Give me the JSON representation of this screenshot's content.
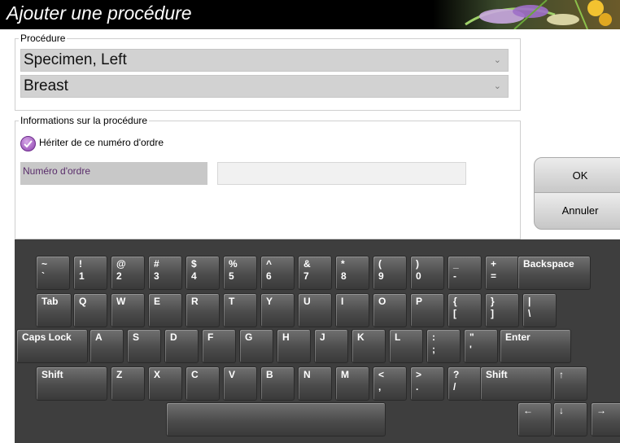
{
  "dialog": {
    "title": "Ajouter une procédure"
  },
  "procedure": {
    "legend": "Procédure",
    "procedure_value": "Specimen, Left",
    "laterality_value": "Breast",
    "chevron": "chevron-down-icon"
  },
  "info": {
    "legend": "Informations sur la procédure",
    "inherit_label": "Hériter de ce numéro d'ordre",
    "inherit_checked": true,
    "order_number_label": "Numéro d'ordre",
    "order_number_value": ""
  },
  "buttons": {
    "ok": "OK",
    "cancel": "Annuler"
  },
  "colors": {
    "title_bar": "#000000",
    "keyboard_bg": "#3e3e3e",
    "check_accent": "#8c3fad"
  },
  "keyboard": {
    "row1": [
      {
        "top": "~",
        "bottom": "`"
      },
      {
        "top": "!",
        "bottom": "1"
      },
      {
        "top": "@",
        "bottom": "2"
      },
      {
        "top": "#",
        "bottom": "3"
      },
      {
        "top": "$",
        "bottom": "4"
      },
      {
        "top": "%",
        "bottom": "5"
      },
      {
        "top": "^",
        "bottom": "6"
      },
      {
        "top": "&",
        "bottom": "7"
      },
      {
        "top": "*",
        "bottom": "8"
      },
      {
        "top": "(",
        "bottom": "9"
      },
      {
        "top": ")",
        "bottom": "0"
      },
      {
        "top": "_",
        "bottom": "-"
      },
      {
        "top": "+",
        "bottom": "="
      },
      {
        "top": "Backspace",
        "bottom": ""
      }
    ],
    "row2": [
      {
        "top": "Tab",
        "bottom": ""
      },
      {
        "top": "Q",
        "bottom": ""
      },
      {
        "top": "W",
        "bottom": ""
      },
      {
        "top": "E",
        "bottom": ""
      },
      {
        "top": "R",
        "bottom": ""
      },
      {
        "top": "T",
        "bottom": ""
      },
      {
        "top": "Y",
        "bottom": ""
      },
      {
        "top": "U",
        "bottom": ""
      },
      {
        "top": "I",
        "bottom": ""
      },
      {
        "top": "O",
        "bottom": ""
      },
      {
        "top": "P",
        "bottom": ""
      },
      {
        "top": "{",
        "bottom": "["
      },
      {
        "top": "}",
        "bottom": "]"
      },
      {
        "top": "|",
        "bottom": "\\"
      }
    ],
    "row3": [
      {
        "top": "Caps Lock",
        "bottom": ""
      },
      {
        "top": "A",
        "bottom": ""
      },
      {
        "top": "S",
        "bottom": ""
      },
      {
        "top": "D",
        "bottom": ""
      },
      {
        "top": "F",
        "bottom": ""
      },
      {
        "top": "G",
        "bottom": ""
      },
      {
        "top": "H",
        "bottom": ""
      },
      {
        "top": "J",
        "bottom": ""
      },
      {
        "top": "K",
        "bottom": ""
      },
      {
        "top": "L",
        "bottom": ""
      },
      {
        "top": ":",
        "bottom": ";"
      },
      {
        "top": "\"",
        "bottom": "'"
      },
      {
        "top": "Enter",
        "bottom": ""
      }
    ],
    "row4": [
      {
        "top": "Shift",
        "bottom": ""
      },
      {
        "top": "Z",
        "bottom": ""
      },
      {
        "top": "X",
        "bottom": ""
      },
      {
        "top": "C",
        "bottom": ""
      },
      {
        "top": "V",
        "bottom": ""
      },
      {
        "top": "B",
        "bottom": ""
      },
      {
        "top": "N",
        "bottom": ""
      },
      {
        "top": "M",
        "bottom": ""
      },
      {
        "top": "<",
        "bottom": ","
      },
      {
        "top": ">",
        "bottom": "."
      },
      {
        "top": "?",
        "bottom": "/"
      },
      {
        "top": "Shift",
        "bottom": ""
      },
      {
        "top": "↑",
        "bottom": ""
      }
    ],
    "row5": [
      {
        "top": "",
        "bottom": ""
      },
      {
        "top": "←",
        "bottom": ""
      },
      {
        "top": "↓",
        "bottom": ""
      },
      {
        "top": "→",
        "bottom": ""
      }
    ]
  }
}
